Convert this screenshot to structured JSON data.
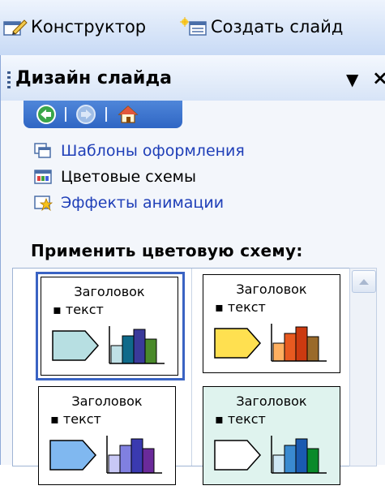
{
  "toolbar": {
    "design_label": "Конструктор",
    "new_slide_label": "Создать слайд",
    "design_icon": "design-pencil-icon",
    "new_slide_icon": "new-slide-icon"
  },
  "pane": {
    "title": "Дизайн слайда",
    "menu_icon": "dropdown-arrow-icon",
    "close_icon": "close-icon",
    "nav": {
      "back_icon": "back-arrow-icon",
      "forward_icon": "forward-arrow-icon",
      "home_icon": "home-icon"
    },
    "links": [
      {
        "label": "Шаблоны оформления",
        "icon": "design-templates-icon",
        "color": "#1f3fb8"
      },
      {
        "label": "Цветовые схемы",
        "icon": "color-schemes-icon",
        "color": "#000000"
      },
      {
        "label": "Эффекты анимации",
        "icon": "animation-effects-icon",
        "color": "#1f3fb8"
      }
    ],
    "apply_label": "Применить цветовую схему:",
    "schemes": [
      {
        "title": "Заголовок",
        "text": "▪ текст",
        "bg": "#ffffff",
        "shape": "#b7dfe2",
        "bars": [
          "#bfe0e6",
          "#0f6a8a",
          "#3a3a9a",
          "#4a8a2a"
        ],
        "selected": true
      },
      {
        "title": "Заголовок",
        "text": "▪ текст",
        "bg": "#ffffff",
        "shape": "#ffe050",
        "bars": [
          "#ffb060",
          "#e85a20",
          "#cc3a10",
          "#9a6a2a"
        ],
        "selected": false
      },
      {
        "title": "Заголовок",
        "text": "▪ текст",
        "bg": "#ffffff",
        "shape": "#80b8f0",
        "bars": [
          "#c8c8f5",
          "#8080e0",
          "#3a3ab0",
          "#6a2a9a"
        ],
        "selected": false
      },
      {
        "title": "Заголовок",
        "text": "▪ текст",
        "bg": "#dff3ee",
        "shape": "#ffffff",
        "bars": [
          "#cfe8f5",
          "#3a8ad0",
          "#1a5ab0",
          "#0a8a2a"
        ],
        "selected": false
      }
    ]
  }
}
